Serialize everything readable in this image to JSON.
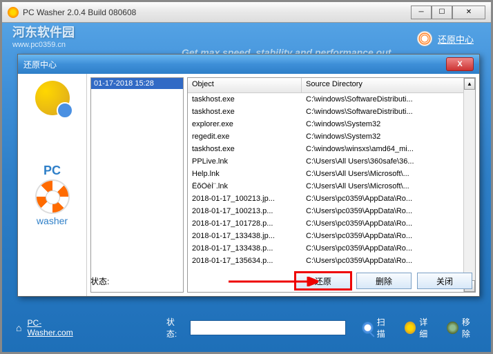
{
  "outer_window": {
    "title": "PC Washer 2.0.4 Build 080608"
  },
  "watermark": {
    "line1": "河东软件园",
    "line2": "www.pc0359.cn"
  },
  "header": {
    "restore_center": "还原中心",
    "tagline": "Get max speed, stability and performance out"
  },
  "inner_dialog": {
    "title": "还原中心",
    "timestamp": "01-17-2018 15:28",
    "table": {
      "col_object": "Object",
      "col_source": "Source Directory",
      "rows": [
        {
          "obj": "taskhost.exe",
          "src": "C:\\windows\\SoftwareDistributi..."
        },
        {
          "obj": "taskhost.exe",
          "src": "C:\\windows\\SoftwareDistributi..."
        },
        {
          "obj": "explorer.exe",
          "src": "C:\\windows\\System32"
        },
        {
          "obj": "regedit.exe",
          "src": "C:\\windows\\System32"
        },
        {
          "obj": "taskhost.exe",
          "src": "C:\\windows\\winsxs\\amd64_mi..."
        },
        {
          "obj": "PPLive.lnk",
          "src": "C:\\Users\\All Users\\360safe\\36..."
        },
        {
          "obj": "Help.lnk",
          "src": "C:\\Users\\All Users\\Microsoft\\..."
        },
        {
          "obj": "ÊõÒèÍ¨.lnk",
          "src": "C:\\Users\\All Users\\Microsoft\\..."
        },
        {
          "obj": "2018-01-17_100213.jp...",
          "src": "C:\\Users\\pc0359\\AppData\\Ro..."
        },
        {
          "obj": "2018-01-17_100213.p...",
          "src": "C:\\Users\\pc0359\\AppData\\Ro..."
        },
        {
          "obj": "2018-01-17_101728.p...",
          "src": "C:\\Users\\pc0359\\AppData\\Ro..."
        },
        {
          "obj": "2018-01-17_133438.jp...",
          "src": "C:\\Users\\pc0359\\AppData\\Ro..."
        },
        {
          "obj": "2018-01-17_133438.p...",
          "src": "C:\\Users\\pc0359\\AppData\\Ro..."
        },
        {
          "obj": "2018-01-17_135634.p...",
          "src": "C:\\Users\\pc0359\\AppData\\Ro..."
        }
      ]
    },
    "status_label": "状态:",
    "buttons": {
      "restore": "还原",
      "delete": "删除",
      "close": "关闭"
    }
  },
  "sidebar_logo": {
    "pc": "PC",
    "washer": "washer"
  },
  "outer_bottom": {
    "link": "PC-Washer.com",
    "status_label": "状态:",
    "scan": "扫描",
    "detail": "详细",
    "remove": "移除"
  }
}
